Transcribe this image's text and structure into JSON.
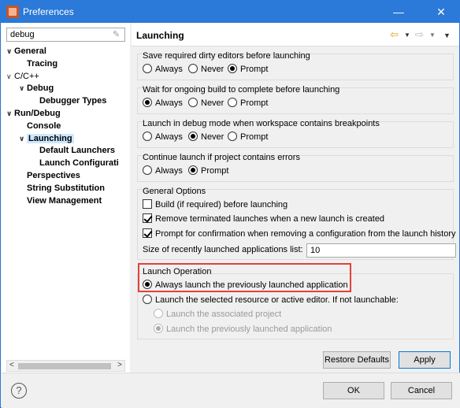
{
  "window": {
    "title": "Preferences",
    "min_glyph": "—",
    "close_glyph": "✕"
  },
  "search": {
    "value": "debug",
    "clear_glyph": "✎"
  },
  "tree": [
    {
      "label": "General",
      "twisty": "∨",
      "bold": true
    },
    {
      "label": "Tracing",
      "twisty": "",
      "bold": true
    },
    {
      "label": "C/C++",
      "twisty": "∨",
      "bold": false
    },
    {
      "label": "Debug",
      "twisty": "∨",
      "bold": true
    },
    {
      "label": "Debugger Types",
      "twisty": "",
      "bold": true
    },
    {
      "label": "Run/Debug",
      "twisty": "∨",
      "bold": true
    },
    {
      "label": "Console",
      "twisty": "",
      "bold": true
    },
    {
      "label": "Launching",
      "twisty": "∨",
      "bold": true,
      "selected": true
    },
    {
      "label": "Default Launchers",
      "twisty": "",
      "bold": true
    },
    {
      "label": "Launch Configurati",
      "twisty": "",
      "bold": true
    },
    {
      "label": "Perspectives",
      "twisty": "",
      "bold": true
    },
    {
      "label": "String Substitution",
      "twisty": "",
      "bold": true
    },
    {
      "label": "View Management",
      "twisty": "",
      "bold": true
    }
  ],
  "scroll": {
    "left": "<",
    "right": ">"
  },
  "page": {
    "title": "Launching",
    "nav": {
      "back": "⇦",
      "dropdown": "▼",
      "forward": "⇨",
      "menu": "▼"
    },
    "save_dirty": {
      "label": "Save required dirty editors before launching",
      "options": [
        "Always",
        "Never",
        "Prompt"
      ],
      "selected": "Prompt"
    },
    "wait_build": {
      "label": "Wait for ongoing build to complete before launching",
      "options": [
        "Always",
        "Never",
        "Prompt"
      ],
      "selected": "Always"
    },
    "debug_mode": {
      "label": "Launch in debug mode when workspace contains breakpoints",
      "options": [
        "Always",
        "Never",
        "Prompt"
      ],
      "selected": "Never"
    },
    "continue_errors": {
      "label": "Continue launch if project contains errors",
      "options": [
        "Always",
        "Prompt"
      ],
      "selected": "Prompt"
    },
    "general": {
      "label": "General Options",
      "build_before": {
        "label": "Build (if required) before launching",
        "checked": false
      },
      "remove_terminated": {
        "label": "Remove terminated launches when a new launch is created",
        "checked": true
      },
      "prompt_remove": {
        "label": "Prompt for confirmation when removing a configuration from the launch history",
        "checked": true
      },
      "history_size_label": "Size of recently launched applications list:",
      "history_size": "10"
    },
    "launch_op": {
      "label": "Launch Operation",
      "always_previous": "Always launch the previously launched application",
      "launch_selected": "Launch the selected resource or active editor. If not launchable:",
      "launch_project": "Launch the associated project",
      "launch_previous": "Launch the previously launched application"
    },
    "restore_defaults": "Restore Defaults",
    "apply": "Apply"
  },
  "footer": {
    "help": "?",
    "ok": "OK",
    "cancel": "Cancel"
  }
}
